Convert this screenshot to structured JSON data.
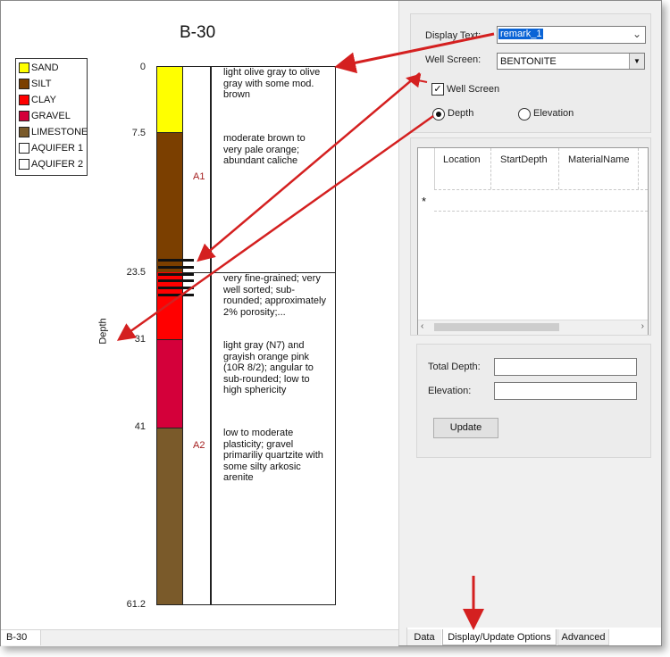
{
  "log": {
    "title": "B-30",
    "depth_label": "Depth",
    "depth_ticks": [
      "0",
      "7.5",
      "23.5",
      "31",
      "41",
      "61.2"
    ],
    "aquifer_labels": [
      "A1",
      "A2"
    ],
    "descriptions": [
      "light olive gray to olive gray with some mod. brown",
      "moderate brown to very pale orange; abundant caliche",
      "very fine-grained; very well sorted; sub-rounded; approximately 2% porosity;...",
      "light gray (N7) and grayish orange pink (10R 8/2); angular to sub-rounded; low to high sphericity",
      "low to moderate plasticity; gravel primariliy quartzite with some silty arkosic arenite"
    ],
    "layer_colors": [
      "#ffff00",
      "#7b3f00",
      "#ff0000",
      "#d4003a",
      "#7a5a2a"
    ]
  },
  "legend": {
    "items": [
      {
        "label": "SAND",
        "color": "#ffff00"
      },
      {
        "label": "SILT",
        "color": "#7b3f00"
      },
      {
        "label": "CLAY",
        "color": "#ff0000"
      },
      {
        "label": "GRAVEL",
        "color": "#d4003a"
      },
      {
        "label": "LIMESTONE",
        "color": "#7a5a2a"
      },
      {
        "label": "AQUIFER 1",
        "color": "#ffffff"
      },
      {
        "label": "AQUIFER 2",
        "color": "#ffffff"
      }
    ]
  },
  "panel": {
    "display_text_label": "Display Text:",
    "display_text_value": "remark_1",
    "well_screen_label": "Well Screen:",
    "well_screen_value": "BENTONITE",
    "well_screen_checkbox": "Well Screen",
    "radio_depth": "Depth",
    "radio_elevation": "Elevation",
    "grid_headers": [
      "Location",
      "StartDepth",
      "MaterialName"
    ],
    "new_row_marker": "*",
    "total_depth_label": "Total Depth:",
    "elevation_label": "Elevation:",
    "update_button": "Update"
  },
  "status": {
    "text": "B-30"
  },
  "tabs": [
    "Data",
    "Display/Update Options",
    "Advanced"
  ]
}
